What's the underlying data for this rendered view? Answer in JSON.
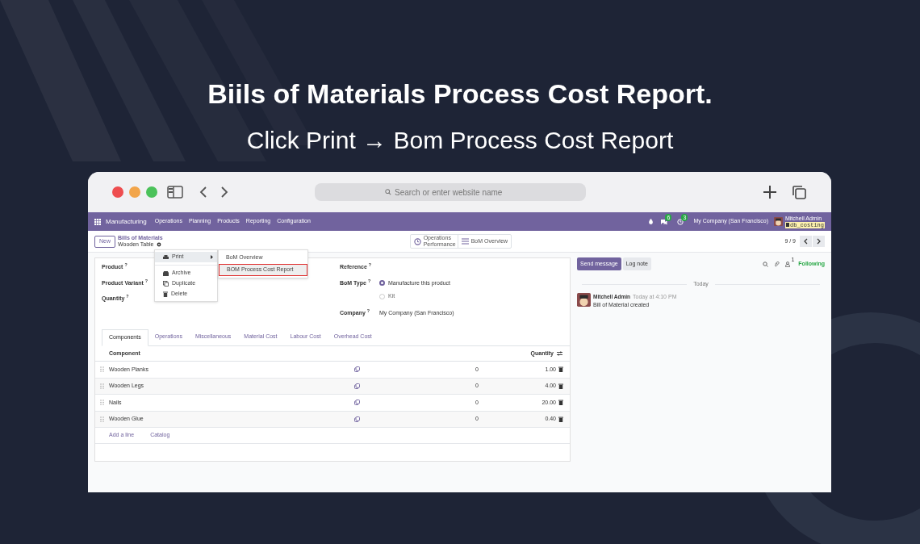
{
  "headline": "Biils of Materials Process Cost Report.",
  "subheadline": "Click Print → Bom Process Cost Report",
  "browser": {
    "address_placeholder": "Search or enter website name"
  },
  "navbar": {
    "app": "Manufacturing",
    "menus": [
      "Operations",
      "Planning",
      "Products",
      "Reporting",
      "Configuration"
    ],
    "message_count": "6",
    "activity_count": "3",
    "company": "My Company (San Francisco)",
    "user": "Mitchell Admin",
    "database": "db_costing"
  },
  "control_panel": {
    "new_button": "New",
    "breadcrumb_parent": "Bills of Materials",
    "record_name": "Wooden Table",
    "smart_buttons": [
      {
        "kind": "clock",
        "label": "Operations Performance"
      },
      {
        "kind": "list",
        "label": "BoM Overview"
      }
    ],
    "pager": "9 / 9"
  },
  "action_menu": {
    "items": [
      {
        "kind": "print",
        "label": "Print",
        "expanded": true
      },
      {
        "kind": "archive",
        "label": "Archive",
        "expanded": false
      },
      {
        "kind": "duplicate",
        "label": "Duplicate",
        "expanded": false
      },
      {
        "kind": "delete",
        "label": "Delete",
        "expanded": false
      }
    ],
    "submenu": [
      {
        "label": "BoM Overview",
        "highlighted": false
      },
      {
        "label": "BOM Process Cost Report",
        "highlighted": true
      }
    ]
  },
  "form": {
    "left_fields": [
      {
        "label": "Product $^{?}$"
      },
      {
        "label": "Product Variant $^{?}$"
      },
      {
        "label": "Quantity $^{?}$"
      }
    ],
    "reference_label": "Reference $^{?}$",
    "bom_type_label": "BoM Type $^{?}$",
    "bom_types": [
      {
        "label": "Manufacture this product",
        "selected": true
      },
      {
        "label": "Kit",
        "selected": false
      }
    ],
    "company_label": "Company $^{?}$",
    "company_value": "My Company (San Francisco)"
  },
  "tabs": [
    {
      "label": "Components",
      "selected": true
    },
    {
      "label": "Operations",
      "selected": false
    },
    {
      "label": "Miscellaneous",
      "selected": false
    },
    {
      "label": "Material Cost",
      "selected": false
    },
    {
      "label": "Labour Cost",
      "selected": false
    },
    {
      "label": "Overhead Cost",
      "selected": false
    }
  ],
  "table": {
    "columns": [
      "Component",
      "Quantity"
    ],
    "rows": [
      {
        "component": "Wooden Planks",
        "column_3": "0",
        "quantity": "1.00"
      },
      {
        "component": "Wooden Legs",
        "column_3": "0",
        "quantity": "4.00"
      },
      {
        "component": "Nails",
        "column_3": "0",
        "quantity": "20.00"
      },
      {
        "component": "Wooden Glue",
        "column_3": "0",
        "quantity": "0.40"
      }
    ],
    "links": [
      "Add a line",
      "Catalog"
    ]
  },
  "chatter": {
    "send_button": "Send message",
    "log_button": "Log note",
    "follower_count": "1",
    "following": "Following",
    "date_separator": "Today",
    "messages": [
      {
        "author": "Mitchell Admin",
        "time": "Today at 4:10 PM",
        "body": "Bill of Material created"
      }
    ]
  }
}
